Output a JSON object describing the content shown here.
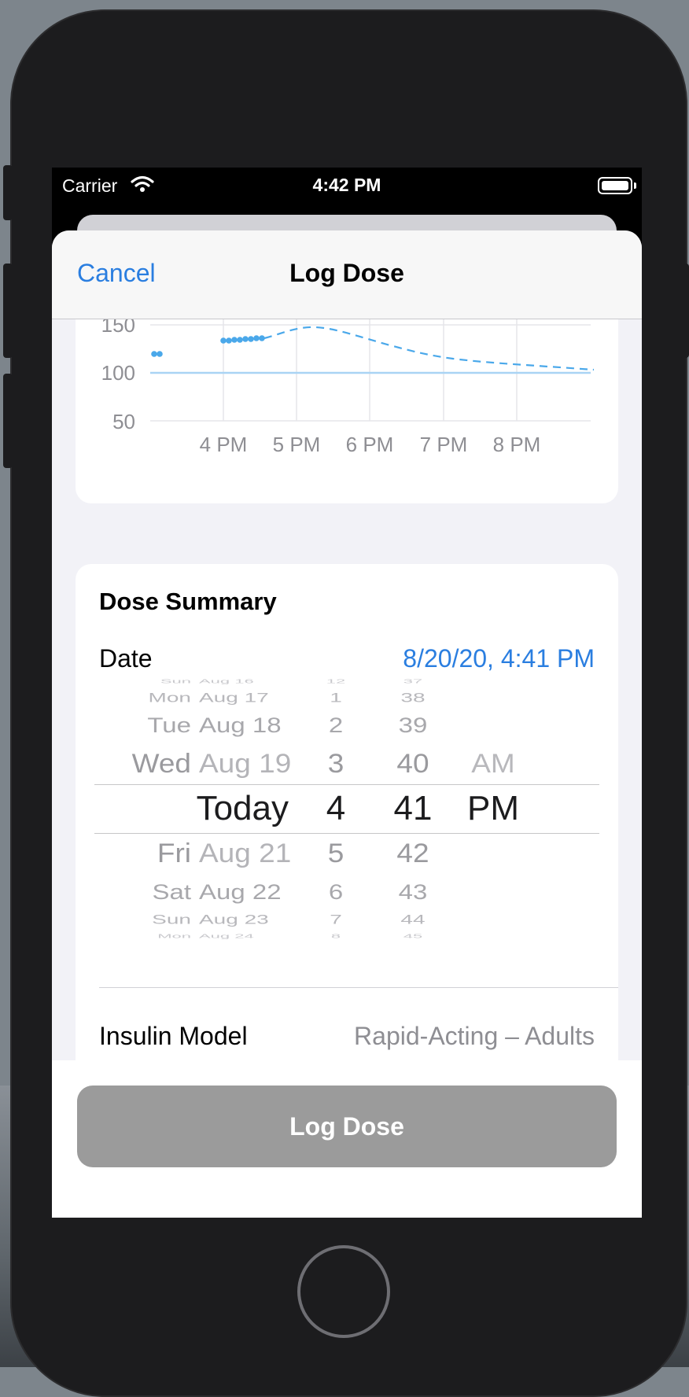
{
  "status_bar": {
    "carrier": "Carrier",
    "time": "4:42 PM"
  },
  "nav": {
    "cancel_label": "Cancel",
    "title": "Log Dose"
  },
  "glucose_chart": {
    "y_ticks": [
      "150",
      "100",
      "50"
    ],
    "x_ticks": [
      "4 PM",
      "5 PM",
      "6 PM",
      "7 PM",
      "8 PM"
    ],
    "target_value": 100,
    "colors": {
      "history": "#4aa8ea",
      "forecast": "#4aa8ea",
      "target": "#a9d4f4",
      "grid": "#e5e5ea"
    }
  },
  "dose_summary": {
    "title": "Dose Summary",
    "date_label": "Date",
    "date_value": "8/20/20, 4:41 PM",
    "picker": {
      "rows": [
        {
          "day": "Sun",
          "date": "Aug 16",
          "hour": "12",
          "minute": "37",
          "ampm": ""
        },
        {
          "day": "Mon",
          "date": "Aug 17",
          "hour": "1",
          "minute": "38",
          "ampm": ""
        },
        {
          "day": "Tue",
          "date": "Aug 18",
          "hour": "2",
          "minute": "39",
          "ampm": ""
        },
        {
          "day": "Wed",
          "date": "Aug 19",
          "hour": "3",
          "minute": "40",
          "ampm": "AM"
        },
        {
          "day": "",
          "date": "Today",
          "hour": "4",
          "minute": "41",
          "ampm": "PM"
        },
        {
          "day": "Fri",
          "date": "Aug 21",
          "hour": "5",
          "minute": "42",
          "ampm": ""
        },
        {
          "day": "Sat",
          "date": "Aug 22",
          "hour": "6",
          "minute": "43",
          "ampm": ""
        },
        {
          "day": "Sun",
          "date": "Aug 23",
          "hour": "7",
          "minute": "44",
          "ampm": ""
        },
        {
          "day": "Mon",
          "date": "Aug 24",
          "hour": "8",
          "minute": "45",
          "ampm": ""
        }
      ]
    },
    "insulin_model_label": "Insulin Model",
    "insulin_model_value": "Rapid-Acting – Adults"
  },
  "footer": {
    "log_button_label": "Log Dose"
  }
}
